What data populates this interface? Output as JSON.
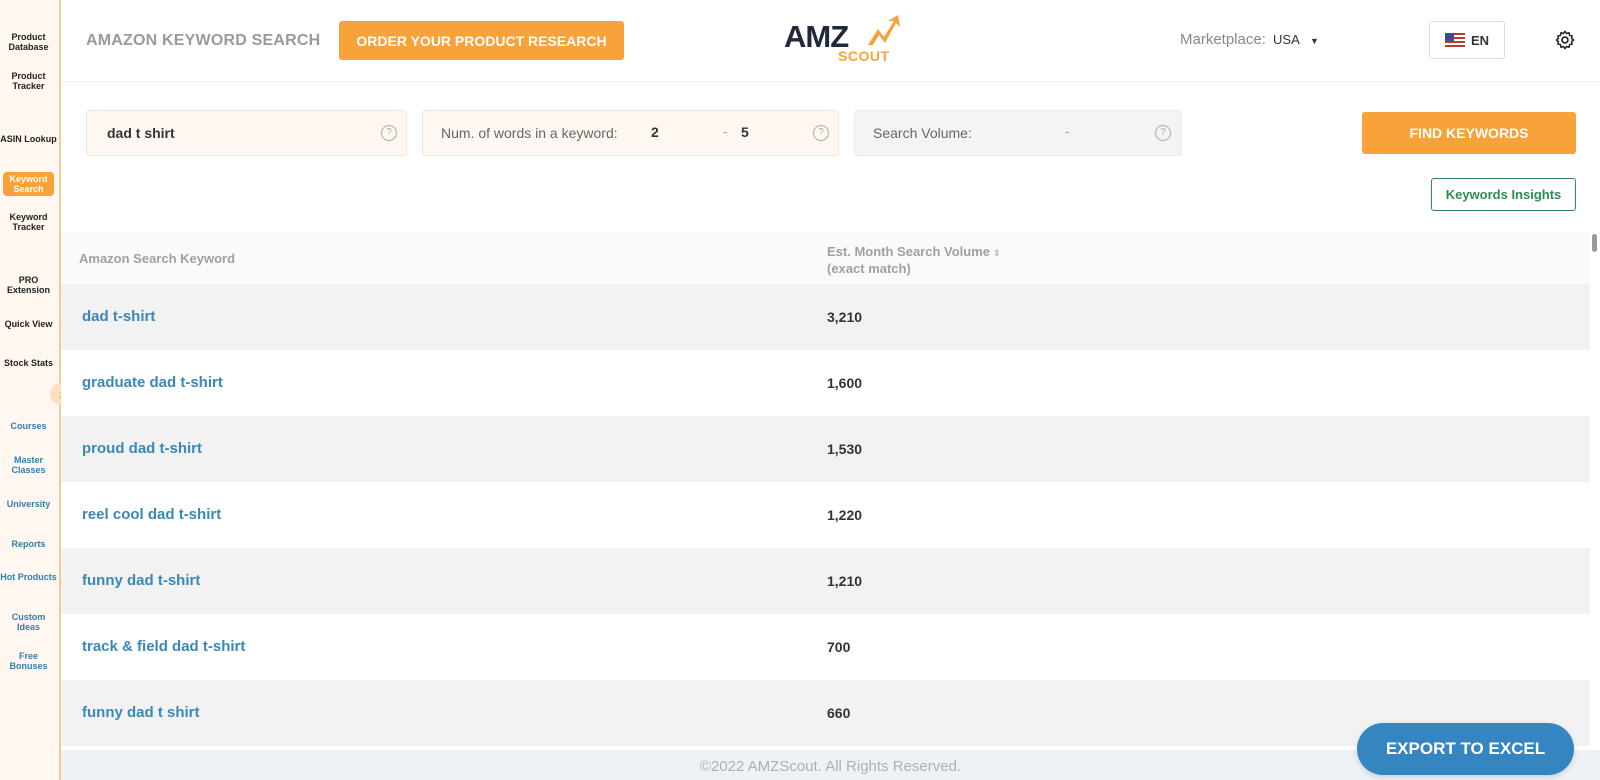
{
  "sidebar": {
    "product_database": "Product Database",
    "product_tracker": "Product Tracker",
    "asin_lookup": "ASIN Lookup",
    "keyword_search": "Keyword Search",
    "keyword_tracker": "Keyword Tracker",
    "pro_extension": "PRO Extension",
    "quick_view": "Quick View",
    "stock_stats": "Stock Stats",
    "courses": "Courses",
    "master_classes": "Master Classes",
    "university": "University",
    "reports": "Reports",
    "hot_products": "Hot Products",
    "custom_ideas": "Custom Ideas",
    "free_bonuses": "Free Bonuses"
  },
  "header": {
    "title": "AMAZON KEYWORD SEARCH",
    "order_button": "ORDER YOUR PRODUCT RESEARCH",
    "logo_main": "AMZ",
    "logo_sub": "SCOUT",
    "marketplace_label": "Marketplace:",
    "marketplace_value": "USA",
    "language": "EN"
  },
  "filters": {
    "keyword_value": "dad t shirt",
    "words_label": "Num. of words in a keyword:",
    "words_min": "2",
    "words_dash": "-",
    "words_max": "5",
    "volume_label": "Search Volume:",
    "volume_dash": "-",
    "help_glyph": "?",
    "find_button": "FIND KEYWORDS",
    "insights_button": "Keywords Insights"
  },
  "table": {
    "col_keyword": "Amazon Search Keyword",
    "col_volume_line1": "Est. Month Search Volume",
    "col_volume_line2": "(exact match)",
    "rows": [
      {
        "keyword": "dad t-shirt",
        "volume": "3,210"
      },
      {
        "keyword": "graduate dad t-shirt",
        "volume": "1,600"
      },
      {
        "keyword": "proud dad t-shirt",
        "volume": "1,530"
      },
      {
        "keyword": "reel cool dad t-shirt",
        "volume": "1,220"
      },
      {
        "keyword": "funny dad t-shirt",
        "volume": "1,210"
      },
      {
        "keyword": "track & field dad t-shirt",
        "volume": "700"
      },
      {
        "keyword": "funny dad t shirt",
        "volume": "660"
      }
    ]
  },
  "footer": {
    "copyright": "©2022 AMZScout. All Rights Reserved.",
    "export_button": "EXPORT TO EXCEL"
  },
  "colors": {
    "accent_orange": "#f9a23a",
    "link_blue": "#3a88b8",
    "export_blue": "#3585c1",
    "insights_green": "#2d8b53"
  }
}
